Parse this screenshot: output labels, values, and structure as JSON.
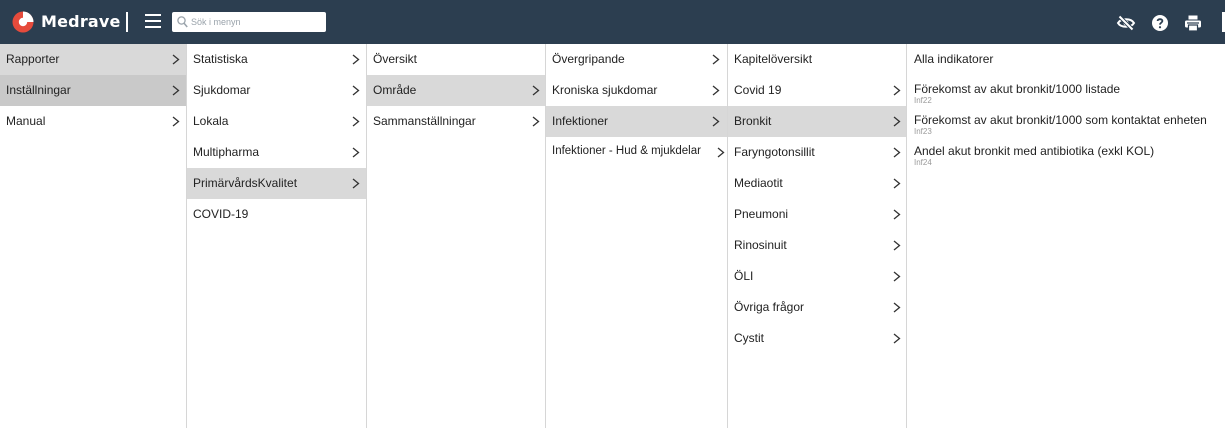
{
  "header": {
    "brand": "Medrave",
    "search_placeholder": "Sök i menyn",
    "colors": {
      "background": "#2c3e50",
      "logo_red": "#e64b3c",
      "logo_white": "#ffffff"
    },
    "icons": [
      "eye-off-icon",
      "help-icon",
      "printer-icon"
    ]
  },
  "columns": [
    {
      "items": [
        {
          "label": "Rapporter",
          "has_children": true,
          "state": "active"
        },
        {
          "label": "Inställningar",
          "has_children": true,
          "state": "selected"
        },
        {
          "label": "Manual",
          "has_children": true,
          "state": "none"
        }
      ]
    },
    {
      "items": [
        {
          "label": "Statistiska",
          "has_children": true,
          "state": "none"
        },
        {
          "label": "Sjukdomar",
          "has_children": true,
          "state": "none"
        },
        {
          "label": "Lokala",
          "has_children": true,
          "state": "none"
        },
        {
          "label": "Multipharma",
          "has_children": true,
          "state": "none"
        },
        {
          "label": "PrimärvårdsKvalitet",
          "has_children": true,
          "state": "active"
        },
        {
          "label": "COVID-19",
          "has_children": false,
          "state": "none"
        }
      ]
    },
    {
      "items": [
        {
          "label": "Översikt",
          "has_children": false,
          "state": "none"
        },
        {
          "label": "Område",
          "has_children": true,
          "state": "active"
        },
        {
          "label": "Sammanställningar",
          "has_children": true,
          "state": "none"
        }
      ]
    },
    {
      "items": [
        {
          "label": "Övergripande",
          "has_children": true,
          "state": "none"
        },
        {
          "label": "Kroniska sjukdomar",
          "has_children": true,
          "state": "none"
        },
        {
          "label": "Infektioner",
          "has_children": true,
          "state": "active"
        },
        {
          "label": "Infektioner - Hud & mjukdelar",
          "has_children": true,
          "state": "none"
        }
      ]
    },
    {
      "items": [
        {
          "label": "Kapitelöversikt",
          "has_children": false,
          "state": "none"
        },
        {
          "label": "Covid 19",
          "has_children": true,
          "state": "none"
        },
        {
          "label": "Bronkit",
          "has_children": true,
          "state": "active"
        },
        {
          "label": "Faryngotonsillit",
          "has_children": true,
          "state": "none"
        },
        {
          "label": "Mediaotit",
          "has_children": true,
          "state": "none"
        },
        {
          "label": "Pneumoni",
          "has_children": true,
          "state": "none"
        },
        {
          "label": "Rinosinuit",
          "has_children": true,
          "state": "none"
        },
        {
          "label": "ÖLI",
          "has_children": true,
          "state": "none"
        },
        {
          "label": "Övriga frågor",
          "has_children": true,
          "state": "none"
        },
        {
          "label": "Cystit",
          "has_children": true,
          "state": "none"
        }
      ]
    }
  ],
  "indicators": [
    {
      "label": "Alla indikatorer",
      "code": ""
    },
    {
      "label": "Förekomst av akut bronkit/1000 listade",
      "code": "Inf22"
    },
    {
      "label": "Förekomst av akut bronkit/1000 som kontaktat enheten",
      "code": "Inf23"
    },
    {
      "label": "Andel akut bronkit med antibiotika (exkl KOL)",
      "code": "Inf24"
    }
  ]
}
